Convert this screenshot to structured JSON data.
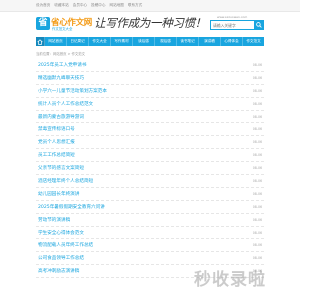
{
  "topbar": [
    "设为首页",
    "收藏本站",
    "会员中心",
    "投稿中心",
    "网站地图",
    "联系方式"
  ],
  "logo": {
    "mark": "省",
    "name": "省心作文网",
    "tagline": "作文范文大全"
  },
  "slogan": "让写作成为一种习惯！",
  "search": {
    "site_url": "www.sxzuowen.com",
    "placeholder": "请输入关键字"
  },
  "nav": [
    "网站首页",
    "日记周记",
    "作文大全",
    "写作素材",
    "读后感",
    "观后感",
    "读书笔记",
    "演讲稿",
    "心得体会",
    "作文范文"
  ],
  "breadcrumb": "当前位置：网站首页 > 作文范文",
  "items": [
    {
      "title": "2025年员工入党申请书",
      "date": "08-06"
    },
    {
      "title": "精选幽默九峰聊天技巧",
      "date": "08-06"
    },
    {
      "title": "小学六一儿童节活动策划方案范本",
      "date": "08-06"
    },
    {
      "title": "统计人员个人工作总结范文",
      "date": "08-06"
    },
    {
      "title": "最新内蒙古旅游导游词",
      "date": "08-06"
    },
    {
      "title": "禁毒宣传标语口号",
      "date": "08-06"
    },
    {
      "title": "党员个人思想汇报",
      "date": "08-06"
    },
    {
      "title": "员工工作总结简短",
      "date": "08-06"
    },
    {
      "title": "父亲节的感言文案简短",
      "date": "08-06"
    },
    {
      "title": "酒店经理年终个人总结简短",
      "date": "08-06"
    },
    {
      "title": "幼儿园园长年终演讲",
      "date": "08-06"
    },
    {
      "title": "2025年暑假假期安全教育六问讲",
      "date": "08-06"
    },
    {
      "title": "劳动节的演讲稿",
      "date": "08-06"
    },
    {
      "title": "学生安全心得体会范文",
      "date": "08-06"
    },
    {
      "title": "物流配载人员年终工作总结",
      "date": "08-06"
    },
    {
      "title": "公司食品领导工作总结",
      "date": "08-06"
    },
    {
      "title": "高考冲刺励志演讲稿",
      "date": "08-06"
    }
  ],
  "watermark": "秒收录啦",
  "colors": {
    "accent": "#19a5df",
    "logo_orange": "#f39a15"
  }
}
